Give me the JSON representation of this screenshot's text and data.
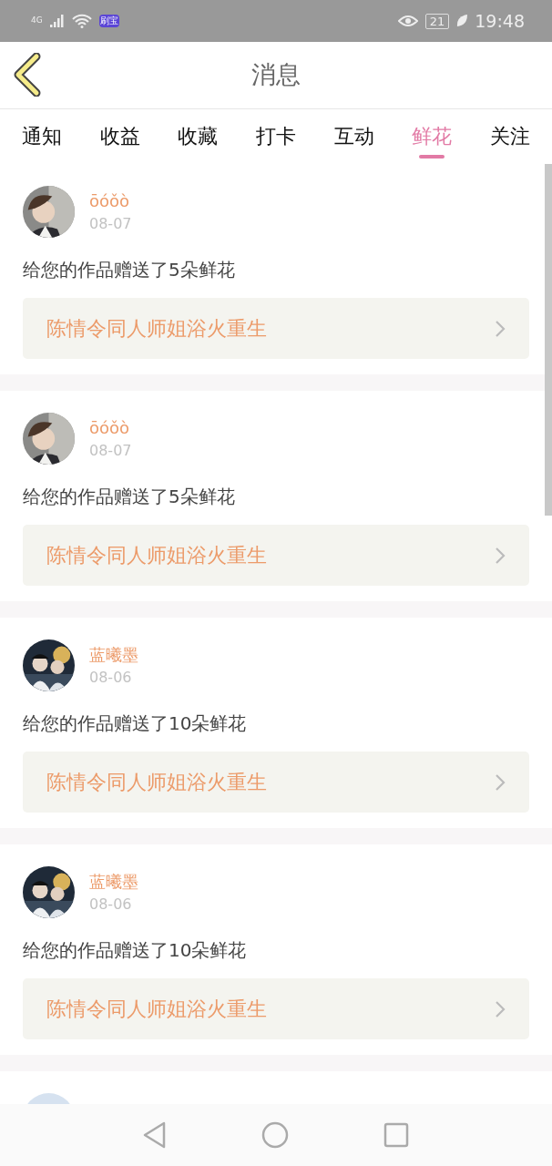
{
  "status_bar": {
    "network": "4G",
    "app_badge": "刷宝",
    "battery": "21",
    "time": "19:48"
  },
  "header": {
    "title": "消息"
  },
  "tabs": [
    {
      "label": "通知",
      "selected": false
    },
    {
      "label": "收益",
      "selected": false
    },
    {
      "label": "收藏",
      "selected": false
    },
    {
      "label": "打卡",
      "selected": false
    },
    {
      "label": "互动",
      "selected": false
    },
    {
      "label": "鲜花",
      "selected": true
    },
    {
      "label": "关注",
      "selected": false
    }
  ],
  "messages": [
    {
      "user": "ōóǒò",
      "date": "08-07",
      "text": "给您的作品赠送了5朵鲜花",
      "work": "陈情令同人师姐浴火重生"
    },
    {
      "user": "ōóǒò",
      "date": "08-07",
      "text": "给您的作品赠送了5朵鲜花",
      "work": "陈情令同人师姐浴火重生"
    },
    {
      "user": "蓝曦墨",
      "date": "08-06",
      "text": "给您的作品赠送了10朵鲜花",
      "work": "陈情令同人师姐浴火重生"
    },
    {
      "user": "蓝曦墨",
      "date": "08-06",
      "text": "给您的作品赠送了10朵鲜花",
      "work": "陈情令同人师姐浴火重生"
    }
  ]
}
